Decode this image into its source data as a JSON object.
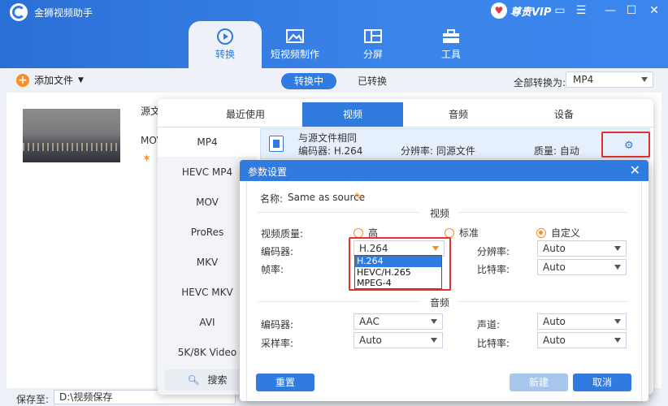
{
  "app": {
    "title": "金狮视频助手",
    "vip_label": "尊贵VIP"
  },
  "nav": [
    {
      "label": "转换",
      "icon": "convert-icon"
    },
    {
      "label": "短视频制作",
      "icon": "image-icon"
    },
    {
      "label": "分屏",
      "icon": "split-screen-icon"
    },
    {
      "label": "工具",
      "icon": "toolbox-icon"
    }
  ],
  "toolbar": {
    "add_file": "添加文件",
    "tab_converting": "转换中",
    "tab_converted": "已转换",
    "convert_all_label": "全部转换为:",
    "convert_all_value": "MP4"
  },
  "file": {
    "source_label": "源文件",
    "format": "MOV"
  },
  "format_panel": {
    "tabs": [
      "最近使用",
      "视频",
      "音频",
      "设备"
    ],
    "formats": [
      "MP4",
      "HEVC MP4",
      "MOV",
      "ProRes",
      "MKV",
      "HEVC MKV",
      "AVI",
      "5K/8K Video"
    ],
    "search": "搜索",
    "preset": {
      "name": "与源文件相同",
      "encoder": "编码器: H.264",
      "resolution": "分辨率: 同源文件",
      "quality": "质量: 自动"
    }
  },
  "dialog": {
    "title": "参数设置",
    "name_label": "名称:",
    "name_value": "Same as source",
    "video_section": "视频",
    "audio_section": "音频",
    "quality_label": "视频质量:",
    "quality_options": [
      "高",
      "标准",
      "自定义"
    ],
    "encoder_label": "编码器:",
    "encoder_value": "H.264",
    "encoder_options": [
      "H.264",
      "HEVC/H.265",
      "MPEG-4"
    ],
    "framerate_label": "帧率:",
    "resolution_label": "分辨率:",
    "resolution_value": "Auto",
    "bitrate_label": "比特率:",
    "bitrate_value": "Auto",
    "audio_encoder_label": "编码器:",
    "audio_encoder_value": "AAC",
    "channel_label": "声道:",
    "channel_value": "Auto",
    "samplerate_label": "采样率:",
    "samplerate_value": "Auto",
    "audio_bitrate_label": "比特率:",
    "audio_bitrate_value": "Auto",
    "reset_button": "重置",
    "new_button": "新建",
    "cancel_button": "取消"
  },
  "bottom": {
    "save_label": "保存至:",
    "save_path": "D:\\视频保存"
  }
}
